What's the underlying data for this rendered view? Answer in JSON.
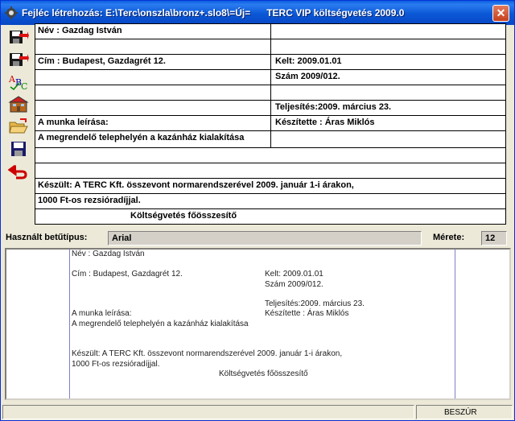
{
  "window": {
    "title_part1": "Fejléc létrehozás: E:\\Terc\\onszla\\bronz+.slo8\\=Új=",
    "title_part2": "TERC VIP költségvetés 2009.0",
    "close_label": "✕"
  },
  "toolbar": {
    "items": [
      {
        "icon": "save-as-icon"
      },
      {
        "icon": "save-template-icon"
      },
      {
        "icon": "spellcheck-icon"
      },
      {
        "icon": "building-icon"
      },
      {
        "icon": "open-folder-icon"
      },
      {
        "icon": "save-icon"
      },
      {
        "icon": "undo-arrow-icon"
      }
    ]
  },
  "form": {
    "nev": "Név : Gazdag István",
    "cim": "Cím : Budapest, Gazdagrét 12.",
    "kelt": "Kelt:      2009.01.01",
    "szam": "Szám    2009/012.",
    "teljesites": "Teljesítés:2009. március 23.",
    "munka_label": "A munka leírása:",
    "keszitette": "Készítette   : Áras Miklós",
    "munka_desc": "A megrendelő telephelyén a kazánház kialakítása",
    "keszult1": "Készült: A TERC Kft. összevont normarendszerével 2009. január 1-i árakon,",
    "keszult2": "1000 Ft-os rezsióradíjjal.",
    "footer_title": "Költségvetés főösszesítő"
  },
  "fontbar": {
    "font_label": "Használt betűtípus:",
    "font_value": "Arial",
    "size_label": "Mérete:",
    "size_value": "12"
  },
  "preview": {
    "nev": "Név : Gazdag István",
    "cim": "Cím : Budapest, Gazdagrét 12.",
    "kelt": "Kelt:      2009.01.01",
    "szam": "Szám    2009/012.",
    "teljesites": "Teljesítés:2009. március 23.",
    "munka_label": "A munka leírása:",
    "keszitette": "Készítette    : Áras Miklós",
    "munka_desc": "A megrendelő telephelyén a kazánház kialakítása",
    "keszult1": "Készült: A TERC Kft. összevont normarendszerével 2009. január 1-i árakon,",
    "keszult2": "1000 Ft-os rezsióradíjjal.",
    "footer_title": "Költségvetés főösszesítő"
  },
  "status": {
    "mode": "BESZÚR"
  }
}
